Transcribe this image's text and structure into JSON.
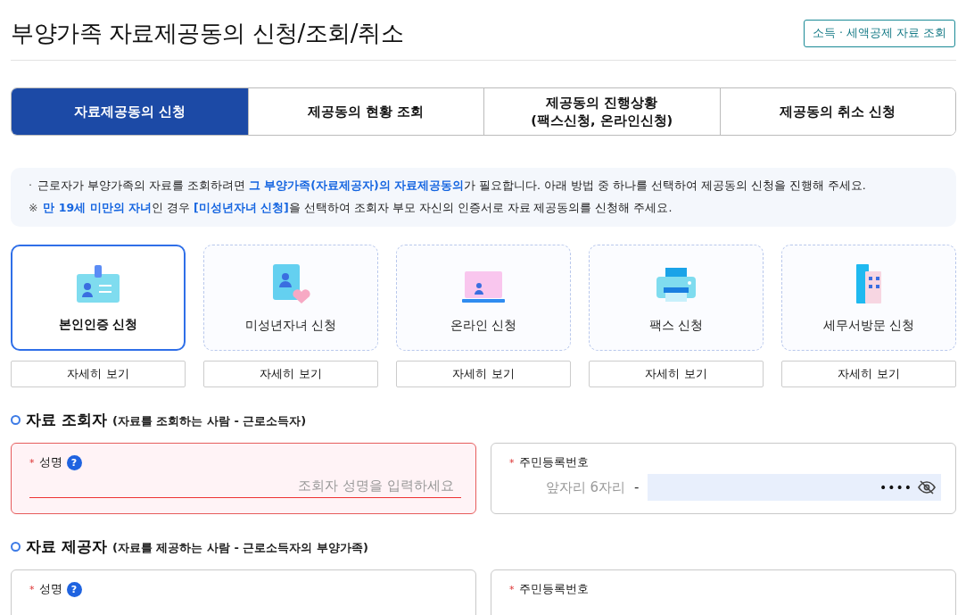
{
  "page_title": "부양가족 자료제공동의 신청/조회/취소",
  "header_link": "소득 · 세액공제 자료 조회",
  "tabs": [
    {
      "label": "자료제공동의 신청",
      "selected": true
    },
    {
      "label": "제공동의 현황 조회",
      "selected": false
    },
    {
      "label": "제공동의 진행상황\n(팩스신청, 온라인신청)",
      "selected": false
    },
    {
      "label": "제공동의 취소 신청",
      "selected": false
    }
  ],
  "notice": [
    {
      "bullet": "·",
      "text": "근로자가 부양가족의 자료를 조회하려면 **그 부양가족(자료제공자)의 자료제공동의**가 필요합니다. 아래 방법 중 하나를 선택하여 제공동의 신청을 진행해 주세요."
    },
    {
      "bullet": "※",
      "text": "**만 19세 미만의 자녀**인 경우 **[미성년자녀 신청]**을 선택하여 조회자 부모 자신의 인증서로 자료 제공동의를 신청해 주세요."
    }
  ],
  "methods": [
    {
      "label": "본인인증 신청",
      "kind": "id-card",
      "selected": true,
      "detail": "자세히 보기"
    },
    {
      "label": "미성년자녀 신청",
      "kind": "child",
      "selected": false,
      "detail": "자세히 보기"
    },
    {
      "label": "온라인 신청",
      "kind": "laptop",
      "selected": false,
      "detail": "자세히 보기"
    },
    {
      "label": "팩스 신청",
      "kind": "fax",
      "selected": false,
      "detail": "자세히 보기"
    },
    {
      "label": "세무서방문 신청",
      "kind": "building",
      "selected": false,
      "detail": "자세히 보기"
    }
  ],
  "sections": [
    {
      "title": "자료 조회자",
      "subtitle": "(자료를 조회하는 사람 - 근로소득자)",
      "name_field": {
        "required": "*",
        "label": "성명",
        "help": "?",
        "placeholder": "조회자 성명을 입력하세요",
        "error": true
      },
      "id_field": {
        "required": "*",
        "label": "주민등록번호",
        "front_placeholder": "앞자리 6자리",
        "separator": "-",
        "back_value": "••••"
      }
    },
    {
      "title": "자료 제공자",
      "subtitle": "(자료를 제공하는 사람 - 근로소득자의 부양가족)",
      "name_field": {
        "required": "*",
        "label": "성명",
        "help": "?",
        "error": false
      },
      "id_field": {
        "required": "*",
        "label": "주민등록번호"
      }
    }
  ]
}
